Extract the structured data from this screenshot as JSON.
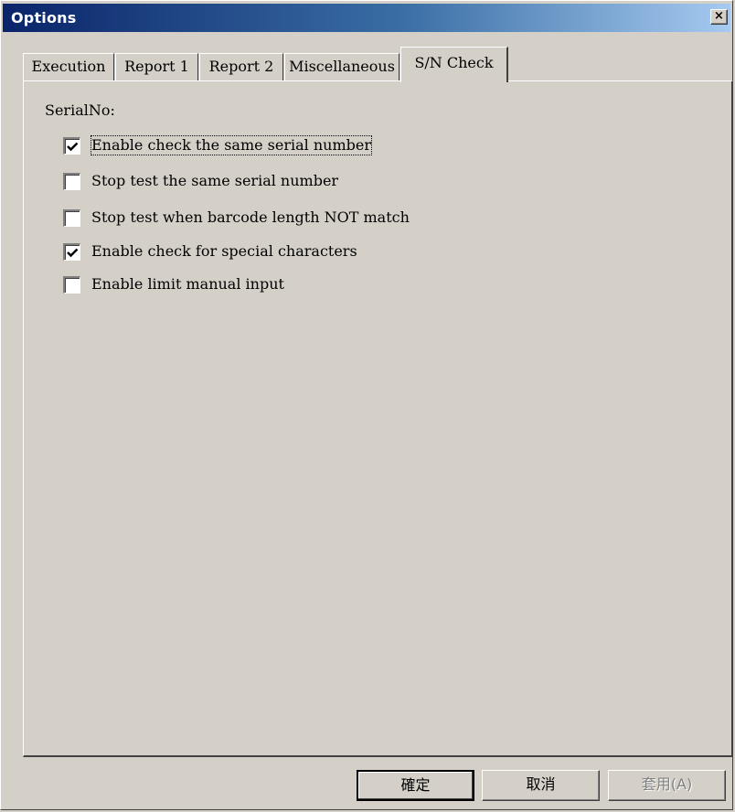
{
  "window": {
    "title": "Options",
    "close_glyph": "×"
  },
  "tabs": [
    {
      "label": "Execution",
      "active": false
    },
    {
      "label": "Report 1",
      "active": false
    },
    {
      "label": "Report 2",
      "active": false
    },
    {
      "label": "Miscellaneous",
      "active": false
    },
    {
      "label": "S/N Check",
      "active": true
    }
  ],
  "sn_check": {
    "group_label": "SerialNo:",
    "options": [
      {
        "label": "Enable check the same serial number",
        "checked": true
      },
      {
        "label": "Stop test the same serial number",
        "checked": false
      },
      {
        "label": "Stop test when barcode length NOT match",
        "checked": false
      },
      {
        "label": "Enable check for special characters",
        "checked": true
      },
      {
        "label": "Enable limit manual input",
        "checked": false
      }
    ]
  },
  "buttons": {
    "ok": "確定",
    "cancel": "取消",
    "apply": "套用(A)"
  },
  "colors": {
    "dialog_face": "#d4d0c8",
    "title_gradient_start": "#0a246a",
    "title_gradient_end": "#a6caf0"
  }
}
